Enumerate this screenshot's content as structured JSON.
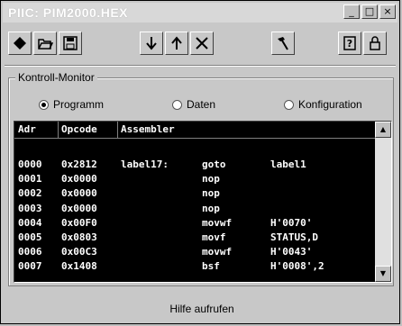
{
  "window": {
    "title": "PIIC: PIM2000.HEX",
    "btn_minimize": "_",
    "btn_maximize": "□",
    "btn_close": "×"
  },
  "toolbar": {
    "icons": [
      "diamond-icon",
      "open-folder-icon",
      "save-disk-icon",
      "arrow-down-icon",
      "arrow-up-icon",
      "cross-icon",
      "hammer-icon",
      "help-icon",
      "lock-icon"
    ]
  },
  "monitor": {
    "group_label": "Kontroll-Monitor",
    "radio_programm": {
      "label": "Programm",
      "selected": true
    },
    "radio_daten": {
      "label": "Daten",
      "selected": false
    },
    "radio_konfiguration": {
      "label": "Konfiguration",
      "selected": false
    }
  },
  "listing": {
    "columns": [
      "Adr",
      "Opcode",
      "Assembler"
    ],
    "rows": [
      {
        "adr": "0000",
        "op": "0x2812",
        "label": "label17:",
        "mn": "goto",
        "arg": "label1"
      },
      {
        "adr": "0001",
        "op": "0x0000",
        "label": "",
        "mn": "nop",
        "arg": ""
      },
      {
        "adr": "0002",
        "op": "0x0000",
        "label": "",
        "mn": "nop",
        "arg": ""
      },
      {
        "adr": "0003",
        "op": "0x0000",
        "label": "",
        "mn": "nop",
        "arg": ""
      },
      {
        "adr": "0004",
        "op": "0x00F0",
        "label": "",
        "mn": "movwf",
        "arg": "H'0070'"
      },
      {
        "adr": "0005",
        "op": "0x0803",
        "label": "",
        "mn": "movf",
        "arg": "STATUS,D"
      },
      {
        "adr": "0006",
        "op": "0x00C3",
        "label": "",
        "mn": "movwf",
        "arg": "H'0043'"
      },
      {
        "adr": "0007",
        "op": "0x1408",
        "label": "",
        "mn": "bsf",
        "arg": "H'0008',2"
      }
    ]
  },
  "footer": {
    "help_label": "Hilfe aufrufen"
  },
  "colors": {
    "listing_bg": "#000000",
    "listing_fg": "#ffffff",
    "window_bg": "#c8c8c8"
  }
}
